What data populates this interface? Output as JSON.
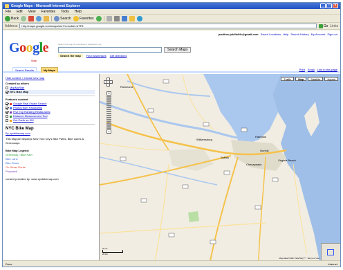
{
  "browser": {
    "title": "Google Maps - Microsoft Internet Explorer",
    "menu": [
      "File",
      "Edit",
      "View",
      "Favorites",
      "Tools",
      "Help"
    ],
    "toolbar": {
      "back": "Back",
      "search": "Search",
      "favorites": "Favorites"
    },
    "address_label": "Address",
    "address_value": "http://maps.google.com/maps/ms?hl=en&ie=UTF8",
    "go": "Go",
    "links": "Links"
  },
  "gmaps": {
    "top_links": [
      "paulhou.jubilislife@gmail.com",
      "Saved Locations",
      "Help",
      "Search History",
      "My Account",
      "Sign out"
    ],
    "logo": "Google",
    "logo_sub": "Maps",
    "search_hint": "Search the map for businesses, addresses, etc.",
    "search_button": "Search Maps",
    "search_tabs": [
      "Search the map",
      "Find businesses",
      "Get directions"
    ],
    "tab_search_results": "Search Results",
    "tab_my_maps": "My Maps",
    "tab_tools": [
      "Print",
      "Email",
      "Link to this page"
    ],
    "sidebar": {
      "top_links": "Hide content  «  Create new map",
      "created_by_others_heading": "Created by others",
      "others": [
        {
          "label": "MapMyRide",
          "checked": false
        },
        {
          "label": "NYC Bike Map",
          "checked": true
        }
      ],
      "featured_heading": "Featured content",
      "featured": [
        {
          "label": "Google Real Estate Search",
          "checked": true,
          "color": "#e04030"
        },
        {
          "label": "Photos from Panoramio",
          "checked": true,
          "color": "#3a6ad8"
        },
        {
          "label": "Five Top Ranking Restaurants",
          "checked": true,
          "color": "#7a3fb0"
        },
        {
          "label": "Distance Measurement Tool",
          "checked": false,
          "color": "#2a9a3a"
        },
        {
          "label": "Get Earth as KM",
          "checked": false,
          "color": "#f0a020"
        }
      ],
      "map_title": "NYC Bike Map",
      "map_author": "By nycbikemap.com",
      "map_description": "This Mapplet displays New York City's Bike Paths, Bike Lanes & Greenways.",
      "legend_heading": "Bike Map Legend:",
      "legend": [
        {
          "label": "Greenway / Bike Path",
          "color": "#2a9a3a"
        },
        {
          "label": "Bike Lane",
          "color": "#3a6ad8"
        },
        {
          "label": "Bike Route",
          "color": "#3a6ad8"
        },
        {
          "label": "On Street Route",
          "color": "#e04030"
        },
        {
          "label": "Proposed",
          "color": "#7a3fb0"
        }
      ],
      "footer": "content provided by: www.nycbikemap.com"
    },
    "map": {
      "types": [
        "Traffic",
        "Map",
        "Satellite",
        "Hybrid"
      ],
      "selected_type": "Map",
      "cities": [
        "Richmond",
        "Williamsburg",
        "Hampton",
        "Norfolk",
        "Virginia Beach",
        "Suffolk",
        "Chesapeake"
      ],
      "scale": [
        "20 mi",
        "20 km"
      ],
      "copyright": "Map data ©2007 NAVTEQ™ - Terms of Use"
    }
  },
  "status": {
    "left": "Done",
    "right": "Internet"
  }
}
